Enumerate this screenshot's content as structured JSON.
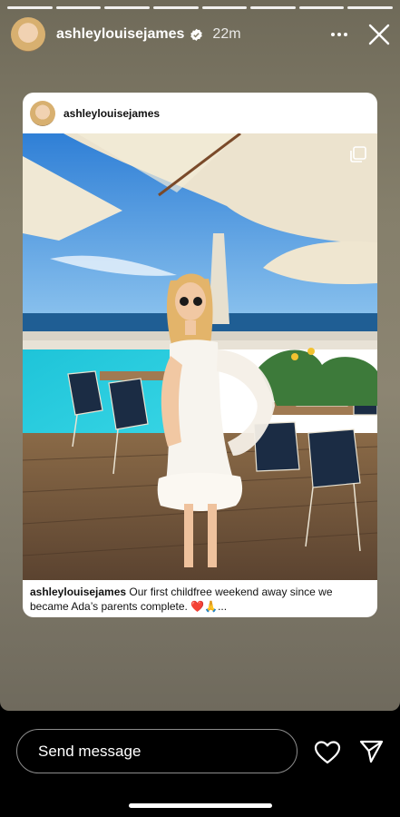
{
  "story": {
    "segments": 8,
    "username": "ashleylouisejames",
    "timestamp": "22m"
  },
  "shared_post": {
    "username": "ashleylouisejames",
    "caption_user": "ashleylouisejames",
    "caption_text": " Our first childfree weekend away since we became Ada’s parents complete. ❤️🙏..."
  },
  "bottom_bar": {
    "message_placeholder": "Send message"
  },
  "icons": {
    "verified": "verified-badge-icon",
    "more": "more-icon",
    "close": "close-icon",
    "multi": "multiple-photos-icon",
    "like": "heart-icon",
    "send": "send-icon"
  },
  "colors": {
    "verified_blue": "#ffffff",
    "story_bg": "#857f6b"
  }
}
